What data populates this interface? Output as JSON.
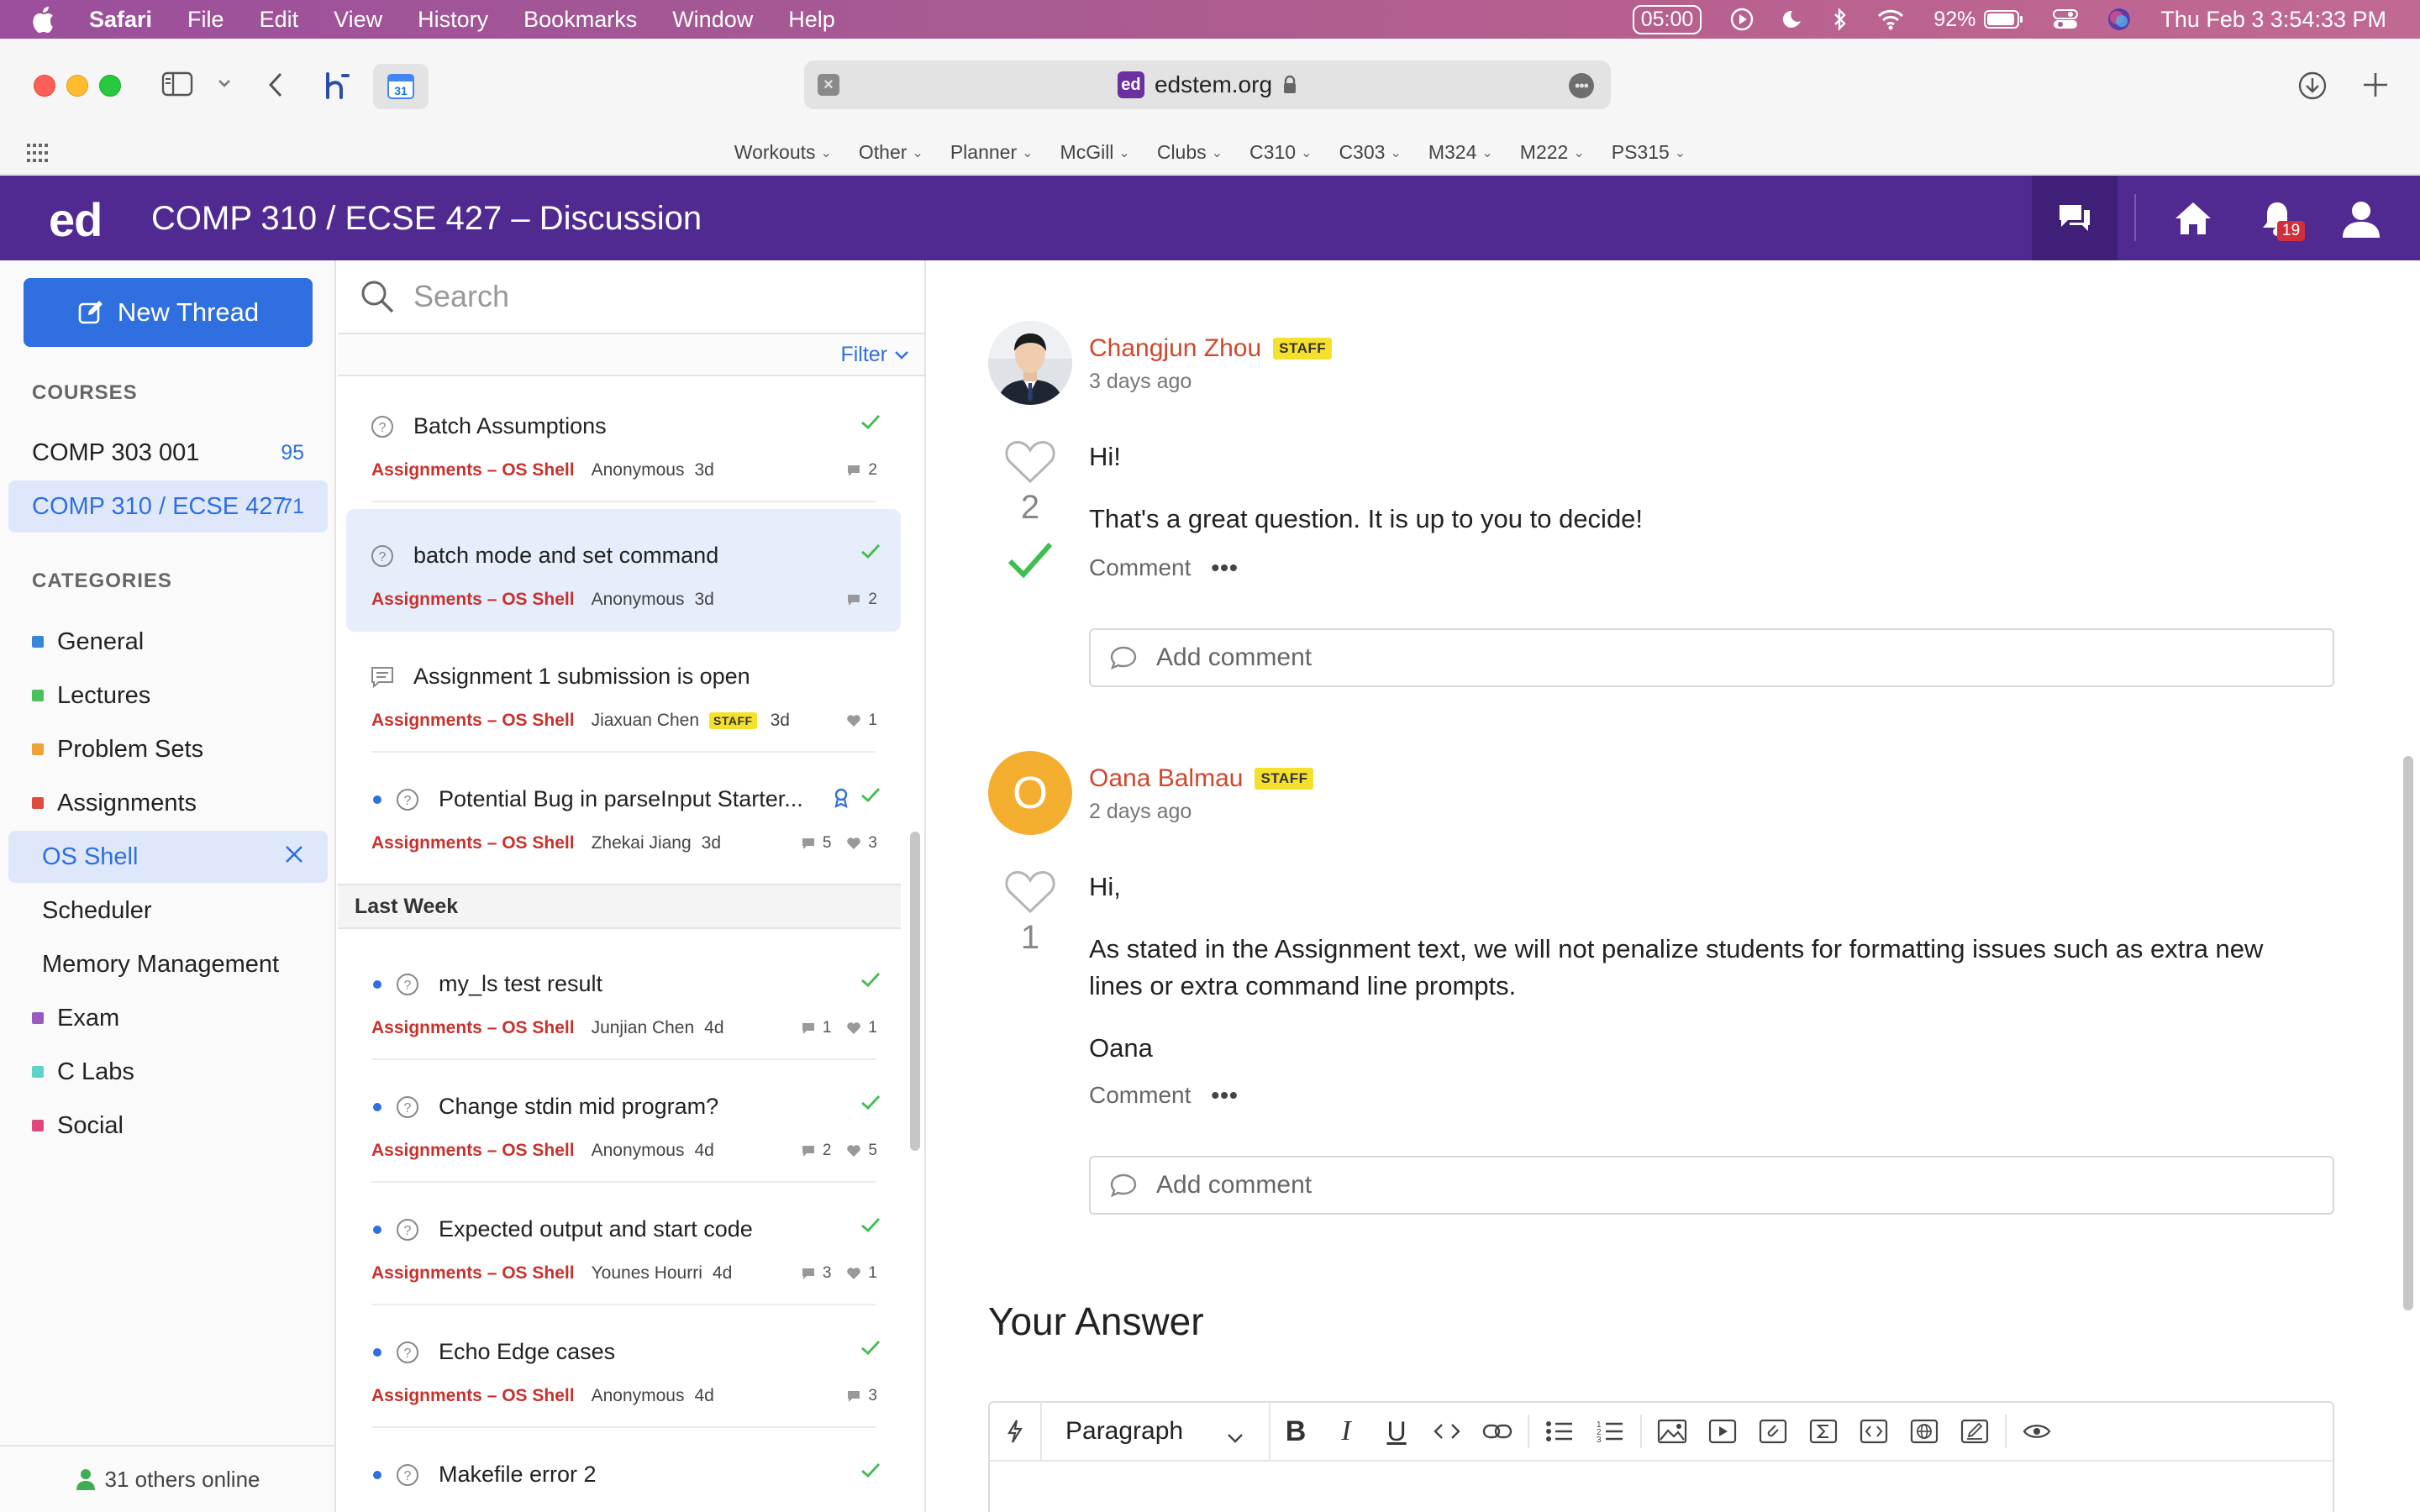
{
  "menubar": {
    "app_name": "Safari",
    "items": [
      "File",
      "Edit",
      "View",
      "History",
      "Bookmarks",
      "Window",
      "Help"
    ],
    "timer": "05:00",
    "battery_pct": "92%",
    "clock": "Thu Feb 3  3:54:33 PM"
  },
  "browser": {
    "url": "edstem.org",
    "favicon_text": "ed",
    "calendar_icon_text": "31"
  },
  "bookmarks": [
    "Workouts",
    "Other",
    "Planner",
    "McGill",
    "Clubs",
    "C310",
    "C303",
    "M324",
    "M222",
    "PS315"
  ],
  "header": {
    "logo": "ed",
    "title": "COMP 310 / ECSE 427 – Discussion",
    "notifications": "19"
  },
  "sidebar": {
    "new_thread": "New Thread",
    "courses_heading": "COURSES",
    "courses": [
      {
        "name": "COMP 303 001",
        "count": "95"
      },
      {
        "name": "COMP 310 / ECSE 427",
        "count": "71"
      }
    ],
    "categories_heading": "CATEGORIES",
    "categories": [
      {
        "name": "General",
        "color": "#3a85d8"
      },
      {
        "name": "Lectures",
        "color": "#4cbf5b"
      },
      {
        "name": "Problem Sets",
        "color": "#f0a23a"
      },
      {
        "name": "Assignments",
        "color": "#e0493d"
      },
      {
        "name": "OS Shell",
        "color": ""
      },
      {
        "name": "Scheduler",
        "color": ""
      },
      {
        "name": "Memory Management",
        "color": ""
      },
      {
        "name": "Exam",
        "color": "#9b59c4"
      },
      {
        "name": "C Labs",
        "color": "#5fd3c8"
      },
      {
        "name": "Social",
        "color": "#e0467e"
      }
    ],
    "online": "31 others online"
  },
  "thread_list": {
    "search_placeholder": "Search",
    "filter": "Filter",
    "week_header": "Last Week",
    "threads": [
      {
        "title": "Batch Assumptions",
        "category": "Assignments – OS Shell",
        "author": "Anonymous",
        "age": "3d",
        "comments": "2",
        "likes": ""
      },
      {
        "title": "batch mode and set command",
        "category": "Assignments – OS Shell",
        "author": "Anonymous",
        "age": "3d",
        "comments": "2",
        "likes": ""
      },
      {
        "title": "Assignment 1 submission is open",
        "category": "Assignments – OS Shell",
        "author": "Jiaxuan Chen",
        "staff": "STAFF",
        "age": "3d",
        "comments": "",
        "likes": "1"
      },
      {
        "title": "Potential Bug in parseInput Starter...",
        "category": "Assignments – OS Shell",
        "author": "Zhekai Jiang",
        "age": "3d",
        "comments": "5",
        "likes": "3"
      },
      {
        "title": "my_ls test result",
        "category": "Assignments – OS Shell",
        "author": "Junjian Chen",
        "age": "4d",
        "comments": "1",
        "likes": "1"
      },
      {
        "title": "Change stdin mid program?",
        "category": "Assignments – OS Shell",
        "author": "Anonymous",
        "age": "4d",
        "comments": "2",
        "likes": "5"
      },
      {
        "title": "Expected output and start code",
        "category": "Assignments – OS Shell",
        "author": "Younes Hourri",
        "age": "4d",
        "comments": "3",
        "likes": "1"
      },
      {
        "title": "Echo Edge cases",
        "category": "Assignments – OS Shell",
        "author": "Anonymous",
        "age": "4d",
        "comments": "3",
        "likes": ""
      },
      {
        "title": "Makefile error 2",
        "category": "",
        "author": "",
        "age": "",
        "comments": "",
        "likes": ""
      }
    ]
  },
  "answers": [
    {
      "name": "Changjun Zhou",
      "staff": "STAFF",
      "time": "3 days ago",
      "votes": "2",
      "paragraphs": [
        "Hi!",
        "That's a great question. It is up to you to decide!"
      ],
      "comment": "Comment",
      "add_comment": "Add comment"
    },
    {
      "name": "Oana Balmau",
      "initial": "O",
      "staff": "STAFF",
      "time": "2 days ago",
      "votes": "1",
      "paragraphs": [
        "Hi,",
        "As stated in the Assignment text, we will not penalize students for formatting issues such as extra new lines or extra command line prompts.",
        "Oana"
      ],
      "comment": "Comment",
      "add_comment": "Add comment"
    }
  ],
  "your_answer": {
    "heading": "Your Answer",
    "paragraph_select": "Paragraph"
  }
}
